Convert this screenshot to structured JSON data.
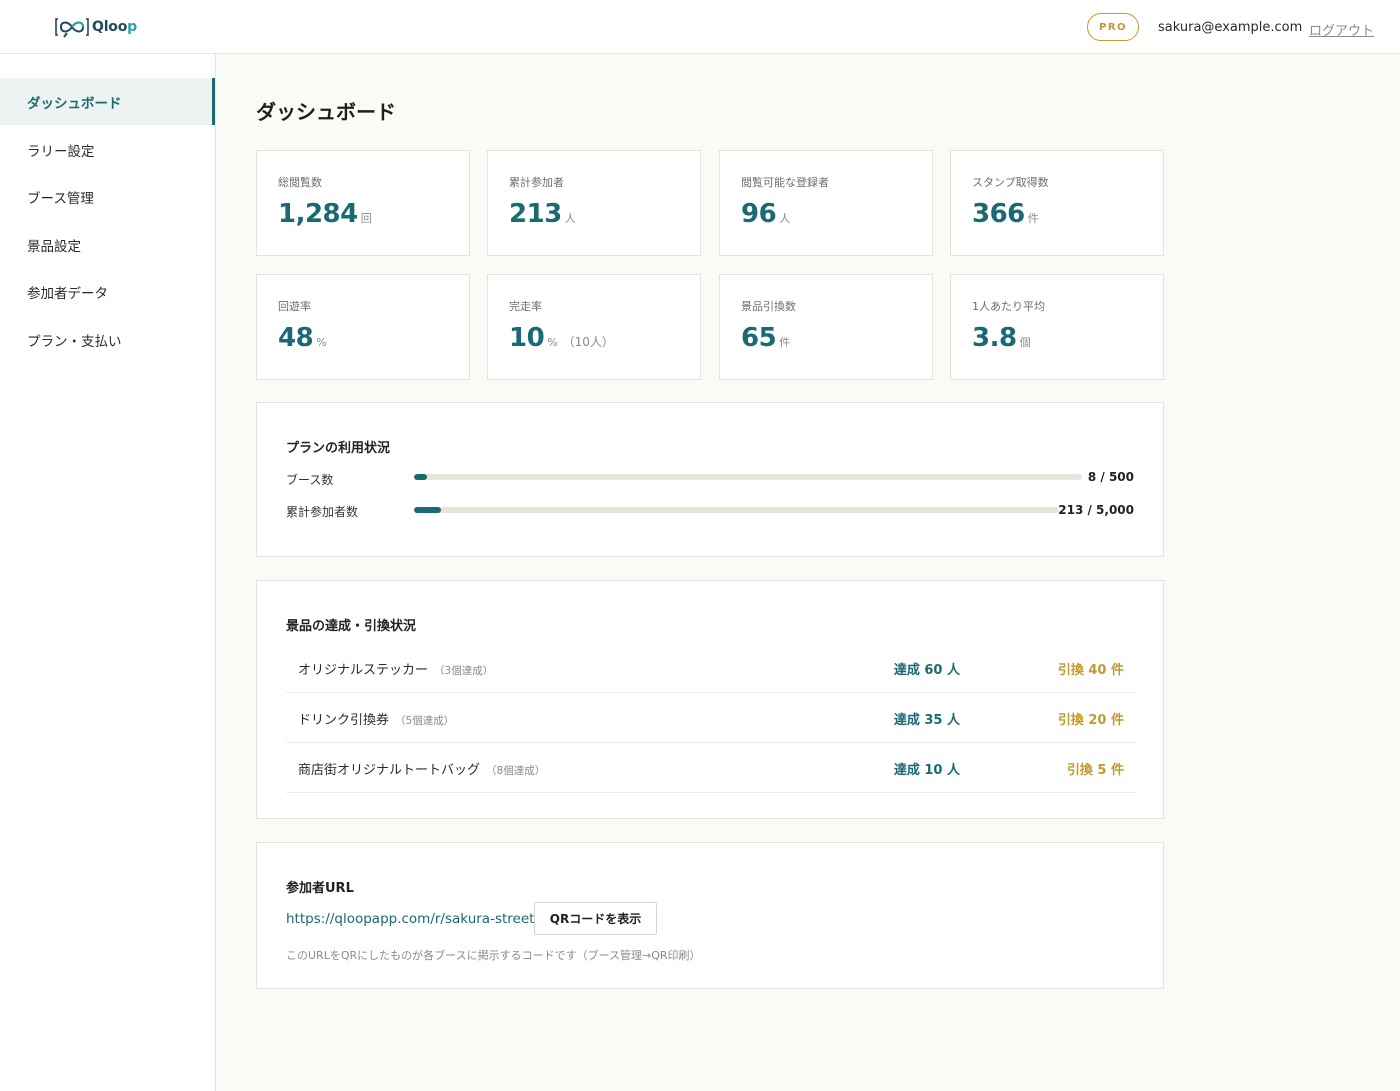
{
  "header": {
    "logo_text_main": "Qloo",
    "logo_text_accent": "p",
    "plan_badge": "PRO",
    "user_email": "sakura@example.com",
    "logout_label": "ログアウト"
  },
  "sidebar": {
    "items": [
      {
        "label": "ダッシュボード",
        "active": true
      },
      {
        "label": "ラリー設定"
      },
      {
        "label": "ブース管理"
      },
      {
        "label": "景品設定"
      },
      {
        "label": "参加者データ"
      },
      {
        "label": "プラン・支払い"
      }
    ]
  },
  "page": {
    "title": "ダッシュボード"
  },
  "stats": [
    {
      "label": "総閲覧数",
      "value": "1,284",
      "unit": "回"
    },
    {
      "label": "累計参加者",
      "value": "213",
      "unit": "人"
    },
    {
      "label": "閲覧可能な登録者",
      "value": "96",
      "unit": "人"
    },
    {
      "label": "スタンプ取得数",
      "value": "366",
      "unit": "件"
    },
    {
      "label": "回遊率",
      "value": "48",
      "unit": "%"
    },
    {
      "label": "完走率",
      "value": "10",
      "unit": "%",
      "sub": "（10人）"
    },
    {
      "label": "景品引換数",
      "value": "65",
      "unit": "件"
    },
    {
      "label": "1人あたり平均",
      "value": "3.8",
      "unit": "個"
    }
  ],
  "plan_usage": {
    "title": "プランの利用状況",
    "rows": [
      {
        "label": "ブース数",
        "count": "8 / 500",
        "fraction": 0.016
      },
      {
        "label": "累計参加者数",
        "count": "213 / 5,000",
        "fraction": 0.0426
      }
    ]
  },
  "prizes": {
    "title": "景品の達成・引換状況",
    "rows": [
      {
        "name": "オリジナルステッカー",
        "requirement": "（3個達成）",
        "achieved": "達成 60 人",
        "exchanged": "引換 40 件"
      },
      {
        "name": "ドリンク引換券",
        "requirement": "（5個達成）",
        "achieved": "達成 35 人",
        "exchanged": "引換 20 件"
      },
      {
        "name": "商店街オリジナルトートバッグ",
        "requirement": "（8個達成）",
        "achieved": "達成 10 人",
        "exchanged": "引換 5 件"
      }
    ]
  },
  "participant_url": {
    "title": "参加者URL",
    "url": "https://qloopapp.com/r/sakura-street",
    "qr_button_label": "QRコードを表示",
    "note": "このURLをQRにしたものが各ブースに掲示するコードです（ブース管理→QR印刷）"
  },
  "colors": {
    "accent": "#1a6a73",
    "gold": "#c39a2e",
    "bar_track": "#e8e5db"
  }
}
